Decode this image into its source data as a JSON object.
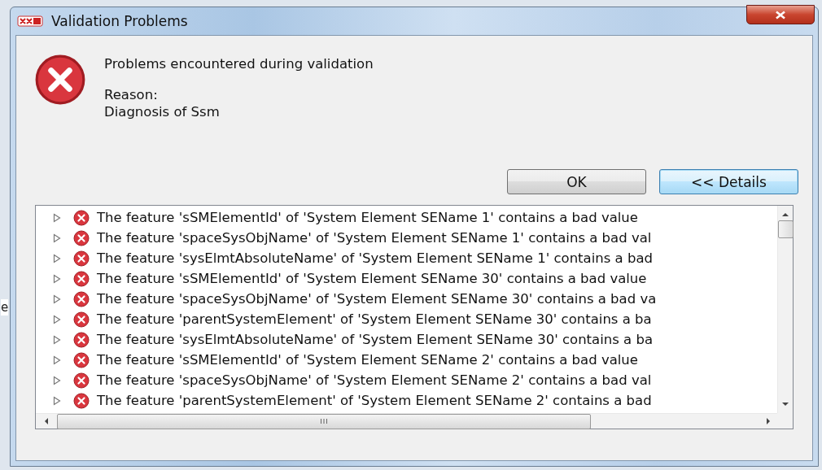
{
  "window": {
    "title": "Validation Problems"
  },
  "message": {
    "title": "Problems encountered during validation",
    "reason_label": "Reason:",
    "reason": "Diagnosis of Ssm"
  },
  "buttons": [
    {
      "label": "OK",
      "kind": "ok"
    },
    {
      "label": "<< Details",
      "kind": "default"
    }
  ],
  "background_text": "e",
  "problems": [
    {
      "text": "The feature 'sSMElementId' of 'System Element SEName 1' contains a bad value",
      "expanded": false
    },
    {
      "text": "The feature 'spaceSysObjName' of 'System Element SEName 1' contains a bad val",
      "expanded": false
    },
    {
      "text": "The feature 'sysElmtAbsoluteName' of 'System Element SEName 1' contains a bad",
      "expanded": false
    },
    {
      "text": "The feature 'sSMElementId' of 'System Element SEName 30' contains a bad value",
      "expanded": false
    },
    {
      "text": "The feature 'spaceSysObjName' of 'System Element SEName 30' contains a bad va",
      "expanded": false
    },
    {
      "text": "The feature 'parentSystemElement' of 'System Element SEName 30' contains a ba",
      "expanded": false
    },
    {
      "text": "The feature 'sysElmtAbsoluteName' of 'System Element SEName 30' contains a ba",
      "expanded": false
    },
    {
      "text": "The feature 'sSMElementId' of 'System Element SEName 2' contains a bad value",
      "expanded": false
    },
    {
      "text": "The feature 'spaceSysObjName' of 'System Element SEName 2' contains a bad val",
      "expanded": false
    },
    {
      "text": "The feature 'parentSystemElement' of 'System Element SEName 2' contains a bad",
      "expanded": false
    }
  ]
}
